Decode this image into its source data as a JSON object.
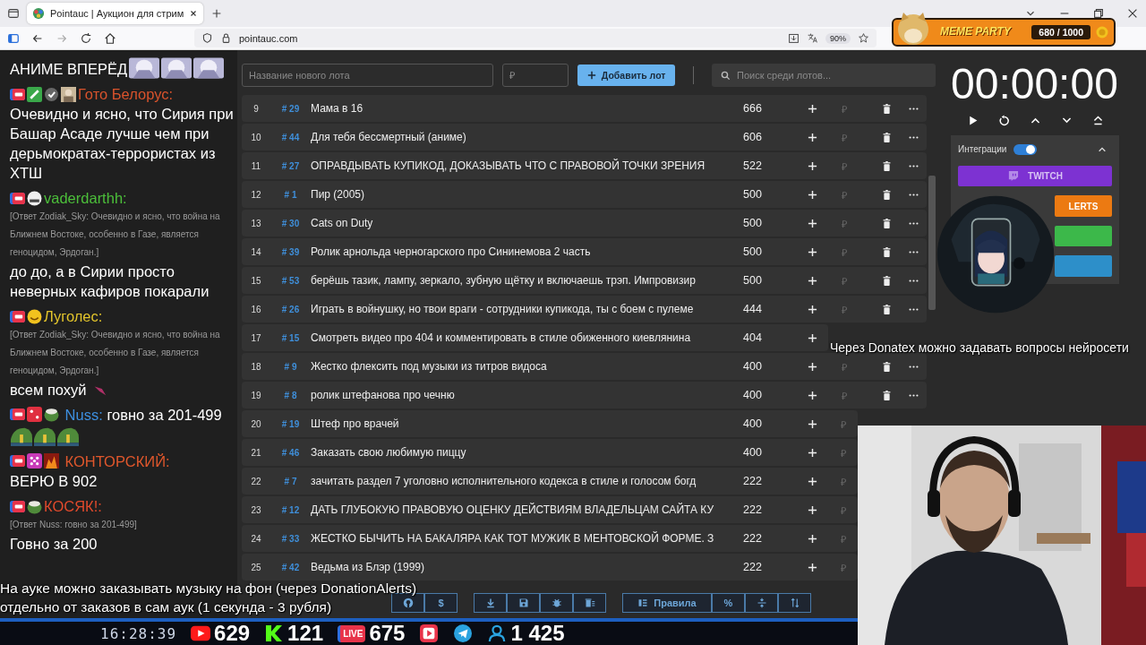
{
  "browser": {
    "tab_title": "Pointauc | Аукцион для стрим",
    "url": "pointauc.com",
    "zoom": "90%"
  },
  "widget": {
    "title": "MEME PARTY",
    "progress": "680 / 1000"
  },
  "chat": [
    {
      "text": "АНИМЕ ВПЕРЁД",
      "emotes": [
        {
          "kind": "anime"
        },
        {
          "kind": "anime"
        },
        {
          "kind": "anime"
        }
      ]
    },
    {
      "badges": [
        {
          "kind": "live"
        },
        {
          "kind": "pen"
        },
        {
          "kind": "check"
        },
        {
          "kind": "avatar"
        }
      ],
      "user": "Гото Белорус:",
      "color": "#d9532c",
      "inline": false,
      "text": "Очевидно и ясно, что Сирия при Башар Асаде лучше чем при дерьмократах-террористах из ХТШ"
    },
    {
      "badges": [
        {
          "kind": "live"
        },
        {
          "kind": "mask"
        }
      ],
      "user": "vaderdarthh:",
      "color": "#4cbf3a",
      "inline": false,
      "reply": "[Ответ Zodiak_Sky: Очевидно и ясно, что война на Ближнем Востоке, особенно в Газе, является геноцидом, Эрдоган.]",
      "text": "до до, а в Сирии просто неверных кафиров покарали"
    },
    {
      "badges": [
        {
          "kind": "live"
        },
        {
          "kind": "smile"
        }
      ],
      "user": "Луголес:",
      "color": "#e3c52c",
      "inline": false,
      "reply": "[Ответ Zodiak_Sky: Очевидно и ясно, что война на Ближнем Востоке, особенно в Газе, является геноцидом, Эрдоган.]",
      "text": "всем похуй",
      "emotes": [
        {
          "kind": "bird"
        }
      ]
    },
    {
      "badges": [
        {
          "kind": "live"
        },
        {
          "kind": "dice"
        },
        {
          "kind": "frog"
        }
      ],
      "user": "Nuss:",
      "color": "#3d8fe0",
      "inline": true,
      "text": "говно за 201-499",
      "emotes": [
        {
          "kind": "frog"
        },
        {
          "kind": "frog"
        },
        {
          "kind": "frog"
        }
      ]
    },
    {
      "badges": [
        {
          "kind": "live"
        },
        {
          "kind": "dots"
        },
        {
          "kind": "fire"
        }
      ],
      "user": "КОНТОРСКИЙ:",
      "color": "#e0572c",
      "inline": true,
      "text": "ВЕРЮ В 902"
    },
    {
      "badges": [
        {
          "kind": "live"
        },
        {
          "kind": "frog"
        }
      ],
      "user": "КОСЯК!:",
      "color": "#e04a2c",
      "inline": false,
      "reply": "[Ответ Nuss: говно за 201-499]",
      "text": "Говно за 200"
    }
  ],
  "lot_form": {
    "name_placeholder": "Название нового лота",
    "amount_placeholder": "₽",
    "add_button": "Добавить лот",
    "search_placeholder": "Поиск среди лотов..."
  },
  "lots": [
    {
      "index": "9",
      "id": "# 29",
      "name": "Мама в 16",
      "amount": "666",
      "actions": [
        {
          "kind": "add"
        },
        {
          "kind": "bid",
          "placeholder": "₽"
        },
        {
          "kind": "delete"
        },
        {
          "kind": "more"
        }
      ]
    },
    {
      "index": "10",
      "id": "# 44",
      "name": "Для тебя бессмертный (аниме)",
      "amount": "606",
      "actions": [
        {
          "kind": "add"
        },
        {
          "kind": "bid",
          "placeholder": "₽"
        },
        {
          "kind": "delete"
        },
        {
          "kind": "more"
        }
      ]
    },
    {
      "index": "11",
      "id": "# 27",
      "name": "ОПРАВДЫВАТЬ КУПИКОД, ДОКАЗЫВАТЬ ЧТО С ПРАВОВОЙ ТОЧКИ ЗРЕНИЯ",
      "amount": "522",
      "actions": [
        {
          "kind": "add"
        },
        {
          "kind": "bid",
          "placeholder": "₽"
        },
        {
          "kind": "delete"
        },
        {
          "kind": "more"
        }
      ]
    },
    {
      "index": "12",
      "id": "# 1",
      "name": "Пир (2005)",
      "amount": "500",
      "actions": [
        {
          "kind": "add"
        },
        {
          "kind": "bid",
          "placeholder": "₽"
        },
        {
          "kind": "delete"
        },
        {
          "kind": "more"
        }
      ]
    },
    {
      "index": "13",
      "id": "# 30",
      "name": "Cats on Duty",
      "amount": "500",
      "actions": [
        {
          "kind": "add"
        },
        {
          "kind": "bid",
          "placeholder": "₽"
        },
        {
          "kind": "delete"
        },
        {
          "kind": "more"
        }
      ]
    },
    {
      "index": "14",
      "id": "# 39",
      "name": "Ролик арнольда черногарского про Сининемова 2 часть",
      "amount": "500",
      "actions": [
        {
          "kind": "add"
        },
        {
          "kind": "bid",
          "placeholder": "₽"
        },
        {
          "kind": "delete"
        },
        {
          "kind": "more"
        }
      ]
    },
    {
      "index": "15",
      "id": "# 53",
      "name": "берёшь тазик, лампу, зеркало, зубную щётку и включаешь трэп. Импровизир",
      "amount": "500",
      "actions": [
        {
          "kind": "add"
        },
        {
          "kind": "bid",
          "placeholder": "₽"
        },
        {
          "kind": "delete"
        },
        {
          "kind": "more"
        }
      ]
    },
    {
      "index": "16",
      "id": "# 26",
      "name": "Играть в войнушку, но твои враги - сотрудники купикода, ты с боем с пулеме",
      "amount": "444",
      "actions": [
        {
          "kind": "add"
        },
        {
          "kind": "bid",
          "placeholder": "₽"
        },
        {
          "kind": "delete"
        },
        {
          "kind": "more"
        }
      ]
    },
    {
      "index": "17",
      "id": "# 15",
      "name": "Смотреть видео про 404 и комментировать в стиле обиженного киевлянина",
      "amount": "404",
      "actions": [
        {
          "kind": "add"
        }
      ]
    },
    {
      "index": "18",
      "id": "# 9",
      "name": "Жестко флексить под музыки из титров видоса",
      "amount": "400",
      "actions": [
        {
          "kind": "add"
        },
        {
          "kind": "bid",
          "placeholder": "₽"
        },
        {
          "kind": "delete"
        },
        {
          "kind": "more"
        }
      ]
    },
    {
      "index": "19",
      "id": "# 8",
      "name": "ролик штефанова про чечню",
      "amount": "400",
      "actions": [
        {
          "kind": "add"
        },
        {
          "kind": "bid",
          "placeholder": "₽"
        },
        {
          "kind": "delete"
        },
        {
          "kind": "more"
        }
      ]
    },
    {
      "index": "20",
      "id": "# 19",
      "name": "Штеф про врачей",
      "amount": "400",
      "actions": [
        {
          "kind": "add"
        },
        {
          "kind": "bid",
          "placeholder": "₽"
        }
      ]
    },
    {
      "index": "21",
      "id": "# 46",
      "name": "Заказать свою любимую пиццу",
      "amount": "400",
      "actions": [
        {
          "kind": "add"
        },
        {
          "kind": "bid",
          "placeholder": "₽"
        }
      ]
    },
    {
      "index": "22",
      "id": "# 7",
      "name": "зачитать раздел 7 уголовно исполнительного кодекса в стиле и голосом богд",
      "amount": "222",
      "actions": [
        {
          "kind": "add"
        },
        {
          "kind": "bid",
          "placeholder": "₽"
        }
      ]
    },
    {
      "index": "23",
      "id": "# 12",
      "name": "ДАТЬ ГЛУБОКУЮ ПРАВОВУЮ ОЦЕНКУ ДЕЙСТВИЯМ ВЛАДЕЛЬЦАМ САЙТА КУ",
      "amount": "222",
      "actions": [
        {
          "kind": "add"
        },
        {
          "kind": "bid",
          "placeholder": "₽"
        }
      ]
    },
    {
      "index": "24",
      "id": "# 33",
      "name": "ЖЕСТКО БЫЧИТЬ НА БАКАЛЯРА КАК ТОТ МУЖИК В МЕНТОВСКОЙ ФОРМЕ. З",
      "amount": "222",
      "actions": [
        {
          "kind": "add"
        },
        {
          "kind": "bid",
          "placeholder": "₽"
        }
      ]
    },
    {
      "index": "25",
      "id": "# 42",
      "name": "Ведьма из Блэр (1999)",
      "amount": "222",
      "actions": [
        {
          "kind": "add"
        },
        {
          "kind": "bid",
          "placeholder": "₽"
        }
      ]
    }
  ],
  "toolbar": [
    {
      "buttons": [
        {
          "kind": "github"
        },
        {
          "kind": "text",
          "label": "$"
        }
      ]
    },
    {
      "buttons": [
        {
          "kind": "download"
        },
        {
          "kind": "save"
        },
        {
          "kind": "bug"
        },
        {
          "kind": "clear"
        }
      ]
    },
    {
      "buttons": [
        {
          "kind": "rules",
          "label": "Правила"
        },
        {
          "kind": "text",
          "label": "%"
        },
        {
          "kind": "split"
        },
        {
          "kind": "sort"
        }
      ]
    }
  ],
  "timer": {
    "time": "00:00:00"
  },
  "integrations": {
    "label": "Интеграции",
    "on": true,
    "expanded": true,
    "buttons": [
      {
        "kind": "twitch",
        "label": "TWITCH",
        "color": "#7d32d2"
      },
      {
        "kind": "alerts",
        "label": "LERTS",
        "color": "#ec7a12"
      },
      {
        "kind": "plain",
        "color": "#3cb84a"
      },
      {
        "kind": "plain",
        "color": "#2d8fc9"
      }
    ]
  },
  "caption_middle": {
    "lines": [
      "Через Donatex можно задавать вопросы нейросети"
    ]
  },
  "caption_bottom": {
    "lines": [
      "На ауке можно заказывать музыку на фон (через DonationAlerts)",
      "отдельно от заказов в сам аук (1 секунда - 3 рубля)"
    ]
  },
  "stream_bar": {
    "time": "16:28:39",
    "stats": [
      {
        "kind": "youtube",
        "value": "629"
      },
      {
        "kind": "kick",
        "value": "121"
      },
      {
        "kind": "live",
        "badge": "LIVE",
        "value": "675"
      },
      {
        "kind": "video"
      },
      {
        "kind": "telegram"
      },
      {
        "kind": "viewers",
        "value": "1 425"
      }
    ]
  }
}
